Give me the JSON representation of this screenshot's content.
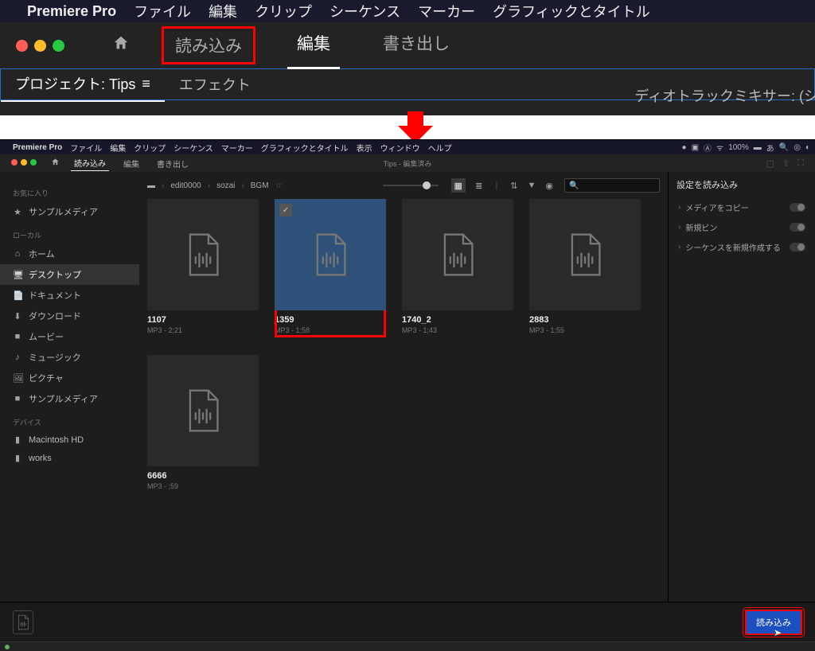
{
  "top": {
    "menubar": [
      "Premiere Pro",
      "ファイル",
      "編集",
      "クリップ",
      "シーケンス",
      "マーカー",
      "グラフィックとタイトル"
    ],
    "tabs": {
      "import": "読み込み",
      "edit": "編集",
      "export": "書き出し"
    },
    "panels": {
      "project": "プロジェクト: Tips",
      "effects": "エフェクト",
      "right_crop": "ディオトラックミキサー: (シ"
    }
  },
  "bottom": {
    "menubar": [
      "Premiere Pro",
      "ファイル",
      "編集",
      "クリップ",
      "シーケンス",
      "マーカー",
      "グラフィックとタイトル",
      "表示",
      "ウィンドウ",
      "ヘルプ"
    ],
    "battery": "100%",
    "tabs": {
      "import": "読み込み",
      "edit": "編集",
      "export": "書き出し"
    },
    "title_center": "Tips - 編集済み",
    "sidebar": {
      "fav_head": "お気に入り",
      "fav": [
        {
          "icon": "★",
          "name": "サンプルメディア"
        }
      ],
      "local_head": "ローカル",
      "local": [
        {
          "icon": "⌂",
          "name": "ホーム"
        },
        {
          "icon": "🖥",
          "name": "デスクトップ",
          "active": true
        },
        {
          "icon": "📄",
          "name": "ドキュメント"
        },
        {
          "icon": "⬇",
          "name": "ダウンロード"
        },
        {
          "icon": "■",
          "name": "ムービー"
        },
        {
          "icon": "♪",
          "name": "ミュージック"
        },
        {
          "icon": "🖼",
          "name": "ピクチャ"
        },
        {
          "icon": "■",
          "name": "サンプルメディア"
        }
      ],
      "dev_head": "デバイス",
      "dev": [
        {
          "icon": "▮",
          "name": "Macintosh HD"
        },
        {
          "icon": "▮",
          "name": "works"
        }
      ]
    },
    "breadcrumb": [
      "edit0000",
      "sozai",
      "BGM"
    ],
    "files": [
      {
        "name": "1107",
        "meta": "MP3 - 2;21"
      },
      {
        "name": "1359",
        "meta": "MP3 - 1;58",
        "selected": true,
        "highlight": true
      },
      {
        "name": "1740_2",
        "meta": "MP3 - 1;43"
      },
      {
        "name": "2883",
        "meta": "MP3 - 1;55"
      },
      {
        "name": "6666",
        "meta": "MP3 - ;59"
      }
    ],
    "right_panel": {
      "head": "設定を読み込み",
      "rows": [
        {
          "label": "メディアをコピー"
        },
        {
          "label": "新規ビン"
        },
        {
          "label": "シーケンスを新規作成する"
        }
      ]
    },
    "footer_button": "読み込み"
  }
}
